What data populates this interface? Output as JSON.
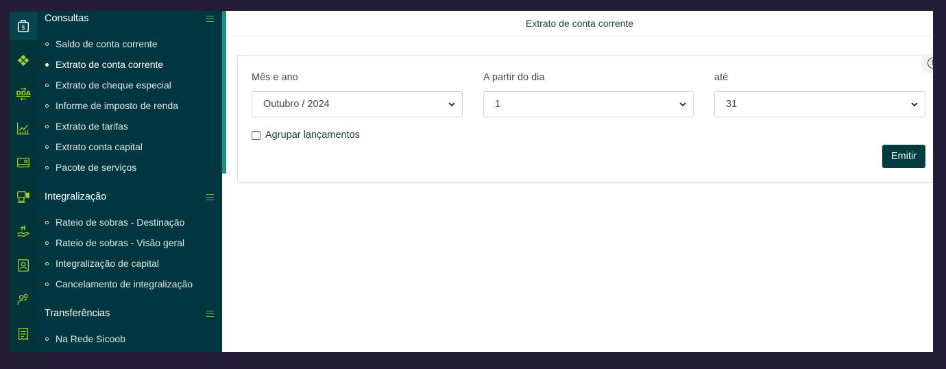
{
  "page": {
    "title": "Extrato de conta corrente"
  },
  "sidebar": {
    "sections": [
      {
        "title": "Consultas",
        "items": [
          {
            "label": "Saldo de conta corrente",
            "active": false
          },
          {
            "label": "Extrato de conta corrente",
            "active": true
          },
          {
            "label": "Extrato de cheque especial",
            "active": false
          },
          {
            "label": "Informe de imposto de renda",
            "active": false
          },
          {
            "label": "Extrato de tarifas",
            "active": false
          },
          {
            "label": "Extrato conta capital",
            "active": false
          },
          {
            "label": "Pacote de serviços",
            "active": false
          }
        ]
      },
      {
        "title": "Integralização",
        "items": [
          {
            "label": "Rateio de sobras - Destinação"
          },
          {
            "label": "Rateio de sobras - Visão geral"
          },
          {
            "label": "Integralização de capital"
          },
          {
            "label": "Cancelamento de integralização"
          }
        ]
      },
      {
        "title": "Transferências",
        "items": [
          {
            "label": "Na Rede Sicoob"
          }
        ]
      }
    ]
  },
  "rail": {
    "icons": [
      "money-bag-icon",
      "clover-icon",
      "dda-icon",
      "chart-icon",
      "card-payment-icon",
      "printer-machine-icon",
      "hand-money-icon",
      "id-badge-icon",
      "people-icon",
      "receipt-icon"
    ],
    "dda_label": "DDA"
  },
  "form": {
    "month_label": "Mês e ano",
    "month_value": "Outubro / 2024",
    "from_label": "A partir do dia",
    "from_value": "1",
    "to_label": "até",
    "to_value": "31",
    "group_label": "Agrupar lançamentos",
    "group_checked": false,
    "emit_label": "Emitir"
  },
  "colors": {
    "sidebar_bg": "#003640",
    "rail_bg": "#02343a",
    "accent_green": "#a3d22f",
    "button_bg": "#003b40",
    "desktop_bg": "#231d35"
  }
}
